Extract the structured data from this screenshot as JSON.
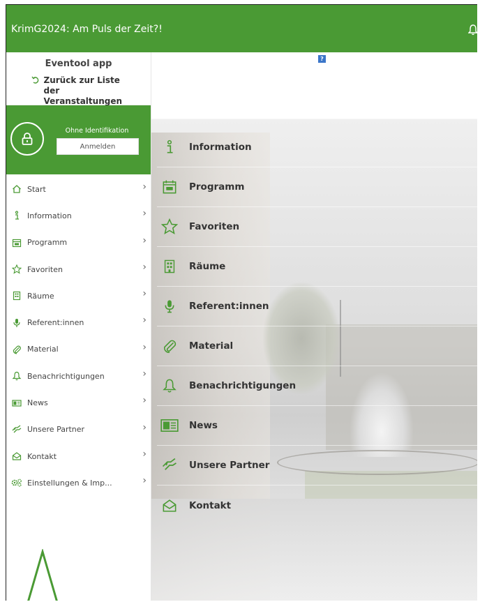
{
  "colors": {
    "brand_green": "#4a9a34",
    "ad_blue": "#3b76c9"
  },
  "header": {
    "title": "KrimG2024: Am Puls der Zeit?!",
    "bell_icon": "bell-icon"
  },
  "sidebar": {
    "app_name": "Eventool app",
    "back_label": "Zurück zur Liste der Veranstaltungen",
    "login": {
      "status": "Ohne Identifikation",
      "button": "Anmelden"
    },
    "items": [
      {
        "label": "Start",
        "icon": "home-icon"
      },
      {
        "label": "Information",
        "icon": "info-icon"
      },
      {
        "label": "Programm",
        "icon": "calendar-icon"
      },
      {
        "label": "Favoriten",
        "icon": "star-icon"
      },
      {
        "label": "Räume",
        "icon": "building-icon"
      },
      {
        "label": "Referent:innen",
        "icon": "microphone-icon"
      },
      {
        "label": "Material",
        "icon": "paperclip-icon"
      },
      {
        "label": "Benachrichtigungen",
        "icon": "bell-icon"
      },
      {
        "label": "News",
        "icon": "news-icon"
      },
      {
        "label": "Unsere Partner",
        "icon": "handshake-icon"
      },
      {
        "label": "Kontakt",
        "icon": "envelope-icon"
      },
      {
        "label": "Einstellungen & Imp...",
        "icon": "settings-icon"
      }
    ]
  },
  "main": {
    "ad_label": "?",
    "tiles": [
      {
        "label": "Information",
        "icon": "info-icon"
      },
      {
        "label": "Programm",
        "icon": "calendar-icon"
      },
      {
        "label": "Favoriten",
        "icon": "star-icon"
      },
      {
        "label": "Räume",
        "icon": "building-icon"
      },
      {
        "label": "Referent:innen",
        "icon": "microphone-icon"
      },
      {
        "label": "Material",
        "icon": "paperclip-icon"
      },
      {
        "label": "Benachrichtigungen",
        "icon": "bell-icon"
      },
      {
        "label": "News",
        "icon": "news-icon"
      },
      {
        "label": "Unsere Partner",
        "icon": "handshake-icon"
      },
      {
        "label": "Kontakt",
        "icon": "envelope-icon"
      }
    ]
  }
}
